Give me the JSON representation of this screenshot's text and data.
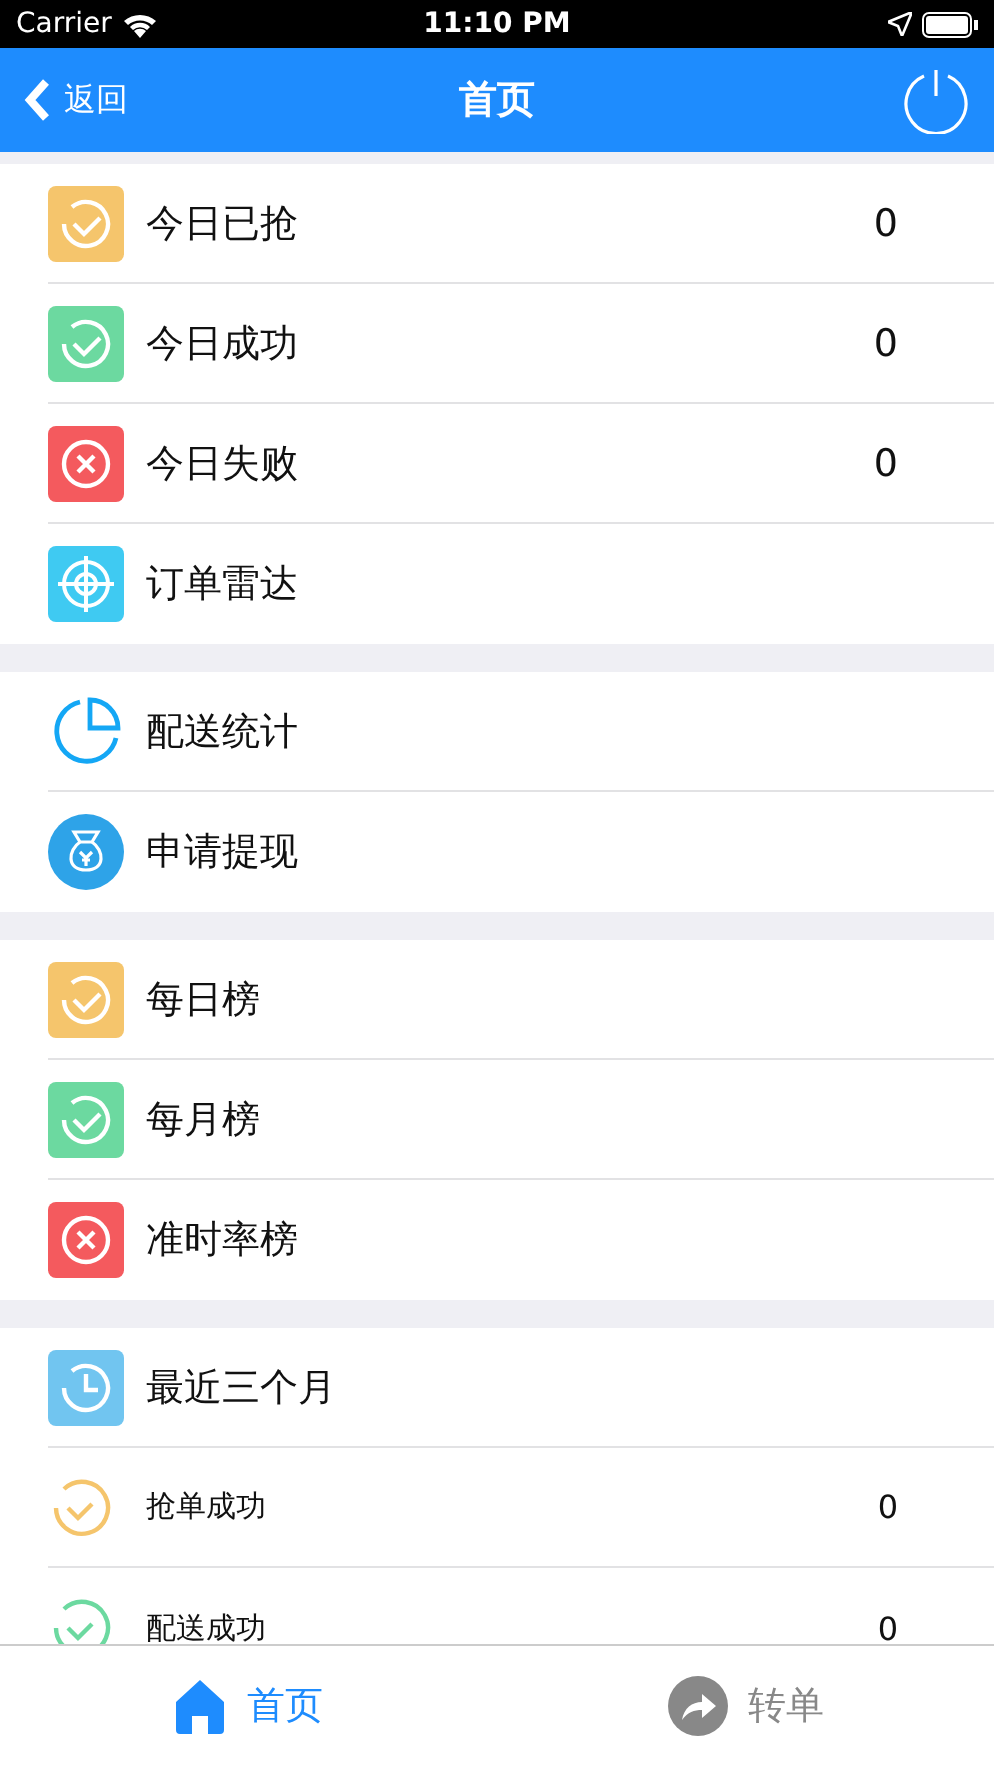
{
  "status_bar": {
    "carrier": "Carrier",
    "time": "11:10 PM"
  },
  "nav_bar": {
    "back": "返回",
    "title": "首页"
  },
  "sections": [
    {
      "rows": [
        {
          "kind": "check",
          "color": "#f5c56c",
          "label": "今日已抢",
          "value": "0"
        },
        {
          "kind": "check",
          "color": "#6cd9a0",
          "label": "今日成功",
          "value": "0"
        },
        {
          "kind": "cross",
          "color": "#f45a5e",
          "label": "今日失败",
          "value": "0"
        },
        {
          "kind": "radar",
          "color": "#3fcaf2",
          "label": "订单雷达"
        }
      ]
    },
    {
      "rows": [
        {
          "kind": "pie",
          "color": "#14a7f5",
          "label": "配送统计"
        },
        {
          "kind": "bag",
          "color": "#2ea3e8",
          "label": "申请提现"
        }
      ]
    },
    {
      "rows": [
        {
          "kind": "check",
          "color": "#f5c56c",
          "label": "每日榜"
        },
        {
          "kind": "check",
          "color": "#6cd9a0",
          "label": "每月榜"
        },
        {
          "kind": "cross",
          "color": "#f45a5e",
          "label": "准时率榜"
        }
      ]
    },
    {
      "rows": [
        {
          "kind": "clock",
          "color": "#71c5f0",
          "label": "最近三个月"
        },
        {
          "kind": "ring",
          "color": "#f5c56c",
          "label": "抢单成功",
          "value": "0"
        },
        {
          "kind": "ring",
          "color": "#6cd9a0",
          "label": "配送成功",
          "value": "0"
        }
      ]
    }
  ],
  "tab_bar": [
    {
      "kind": "home",
      "label": "首页",
      "selected": true
    },
    {
      "kind": "share",
      "label": "转单",
      "selected": false
    }
  ]
}
